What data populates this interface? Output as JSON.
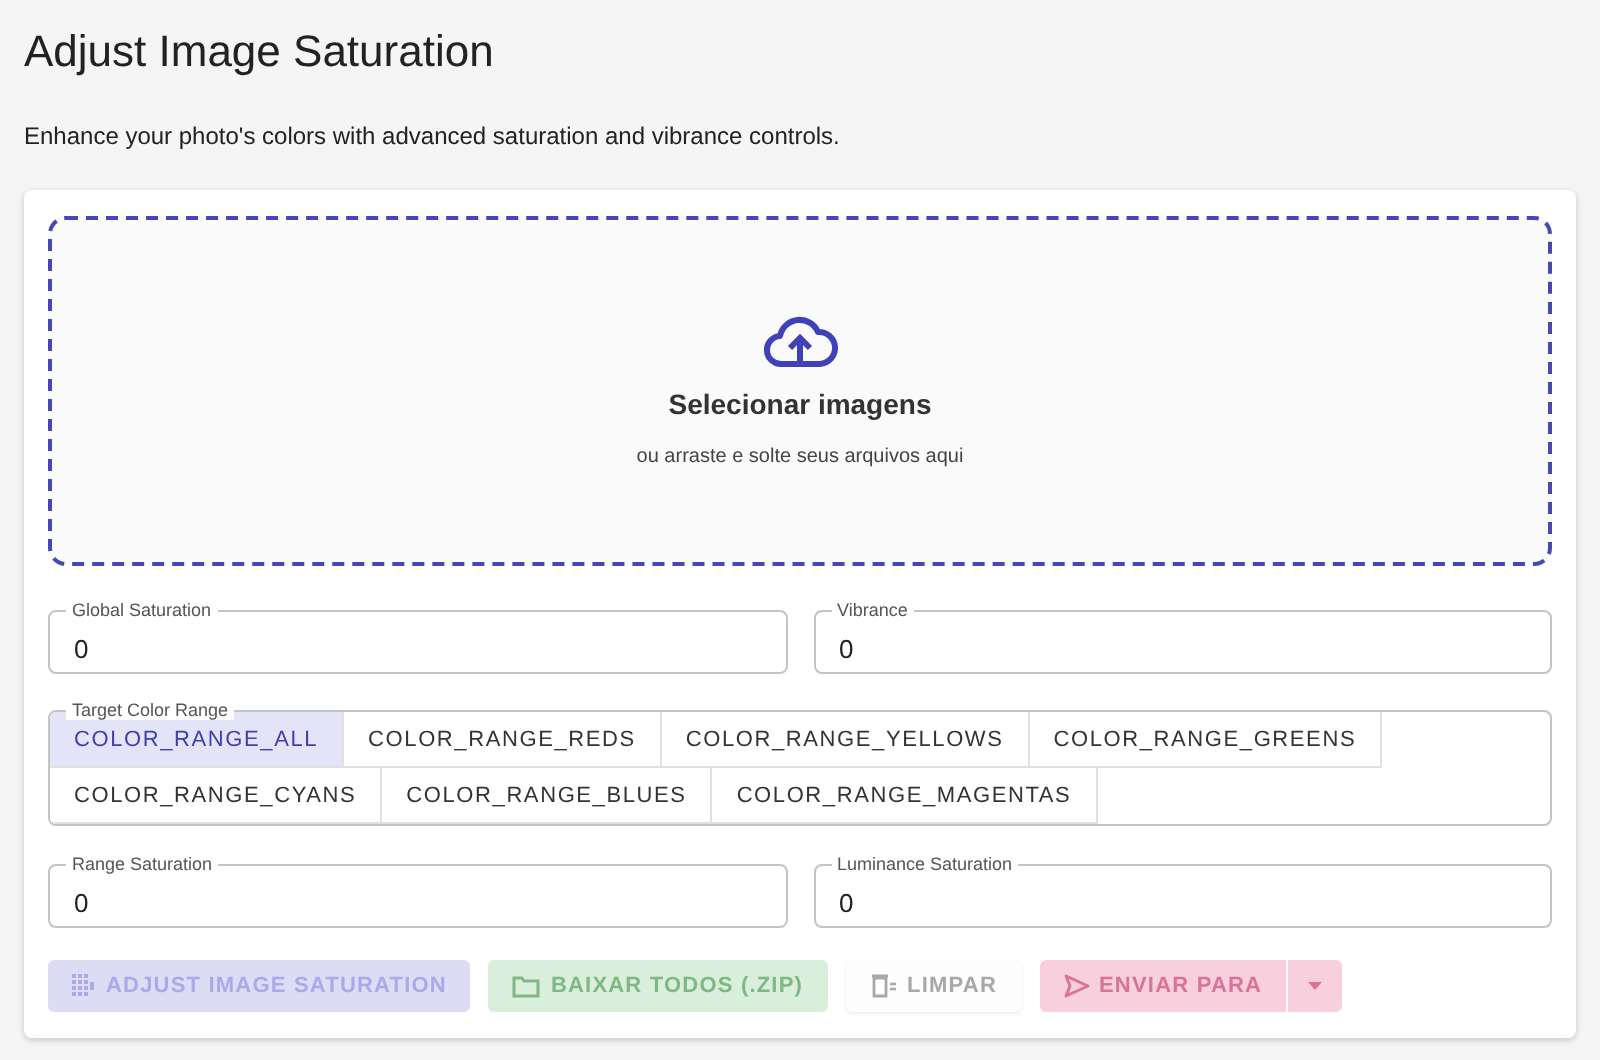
{
  "title": "Adjust Image Saturation",
  "description": "Enhance your photo's colors with advanced saturation and vibrance controls.",
  "dropzone": {
    "heading": "Selecionar imagens",
    "hint": "ou arraste e solte seus arquivos aqui"
  },
  "fields_top": [
    {
      "label": "Global Saturation",
      "value": "0"
    },
    {
      "label": "Vibrance",
      "value": "0"
    }
  ],
  "color_range": {
    "label": "Target Color Range",
    "options": [
      {
        "label": "COLOR_RANGE_ALL",
        "selected": true
      },
      {
        "label": "COLOR_RANGE_REDS",
        "selected": false
      },
      {
        "label": "COLOR_RANGE_YELLOWS",
        "selected": false
      },
      {
        "label": "COLOR_RANGE_GREENS",
        "selected": false
      },
      {
        "label": "COLOR_RANGE_CYANS",
        "selected": false
      },
      {
        "label": "COLOR_RANGE_BLUES",
        "selected": false
      },
      {
        "label": "COLOR_RANGE_MAGENTAS",
        "selected": false
      }
    ]
  },
  "fields_bottom": [
    {
      "label": "Range Saturation",
      "value": "0"
    },
    {
      "label": "Luminance Saturation",
      "value": "0"
    }
  ],
  "buttons": [
    {
      "kind": "primary",
      "label": "ADJUST IMAGE SATURATION",
      "disabled": true
    },
    {
      "kind": "success",
      "label": "BAIXAR TODOS (.ZIP)",
      "disabled": true
    },
    {
      "kind": "plain",
      "label": "LIMPAR",
      "disabled": true
    },
    {
      "kind": "split",
      "label": "ENVIAR PARA",
      "disabled": true
    }
  ]
}
